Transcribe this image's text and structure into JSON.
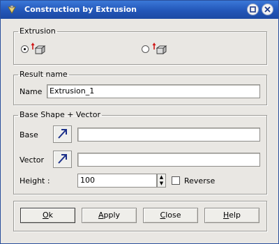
{
  "window": {
    "title": "Construction by Extrusion"
  },
  "extrusion": {
    "legend": "Extrusion",
    "options": [
      {
        "selected": true,
        "icon": "extrude-cube-red-arrow-icon"
      },
      {
        "selected": false,
        "icon": "extrude-cube-arrow-icon"
      }
    ]
  },
  "result": {
    "legend": "Result name",
    "name_label": "Name",
    "name_value": "Extrusion_1"
  },
  "base_shape": {
    "legend": "Base Shape + Vector",
    "base_label": "Base",
    "base_value": "",
    "vector_label": "Vector",
    "vector_value": "",
    "height_label": "Height :",
    "height_value": "100",
    "reverse_label": "Reverse",
    "reverse_checked": false
  },
  "buttons": {
    "ok": {
      "mnemonic": "O",
      "rest": "k"
    },
    "apply": {
      "mnemonic": "A",
      "rest": "pply"
    },
    "close": {
      "mnemonic": "C",
      "rest": "lose"
    },
    "help": {
      "mnemonic": "H",
      "rest": "elp"
    }
  },
  "colors": {
    "titlebar": "#2356b8",
    "accent_arrow": "#d01818",
    "dialog_bg": "#e9e7e3"
  }
}
